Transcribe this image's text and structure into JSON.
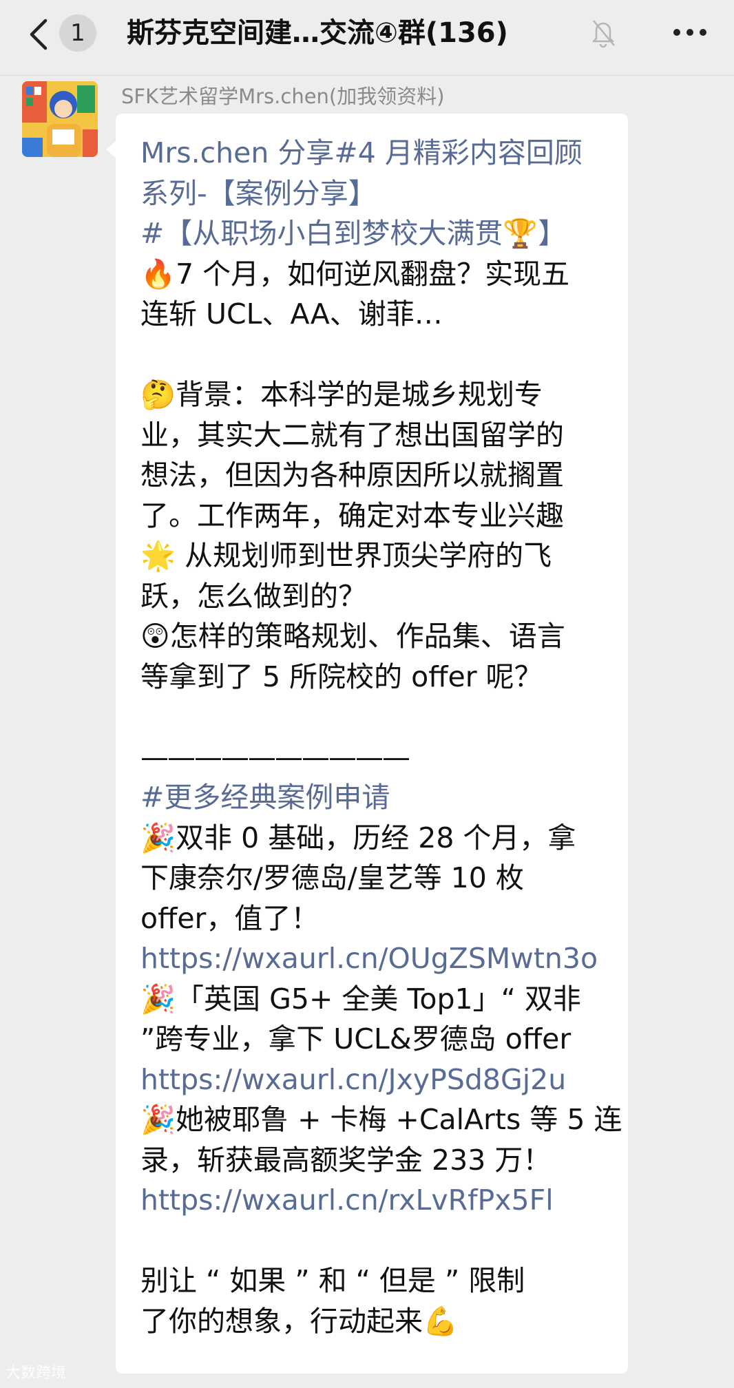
{
  "header": {
    "unread_count": "1",
    "title": "斯芬克空间建…交流④群(136)",
    "icons": {
      "back": "chevron-left-icon",
      "mute": "bell-muted-icon",
      "more": "more-dots-icon"
    }
  },
  "message": {
    "sender": "SFK艺术留学Mrs.chen(加我领资料)",
    "lines": [
      {
        "type": "mixed",
        "parts": [
          "Mrs.chen 分享",
          "#4 月精彩内容回顾"
        ]
      },
      {
        "type": "tag",
        "text": "系列-【案例分享】"
      },
      {
        "type": "tag",
        "text": " #【从职场小白到梦校大满贯🏆】"
      },
      {
        "type": "text",
        "text": " 🔥7 个月，如何逆风翻盘？实现五"
      },
      {
        "type": "text",
        "text": "连斩 UCL、AA、谢菲…"
      },
      {
        "type": "blank",
        "text": ""
      },
      {
        "type": "text",
        "text": "🤔背景：本科学的是城乡规划专"
      },
      {
        "type": "text",
        "text": "业，其实大二就有了想出国留学的"
      },
      {
        "type": "text",
        "text": "想法，但因为各种原因所以就搁置"
      },
      {
        "type": "text",
        "text": "了。工作两年，确定对本专业兴趣"
      },
      {
        "type": "text",
        "text": "🌟 从规划师到世界顶尖学府的飞"
      },
      {
        "type": "text",
        "text": "跃，怎么做到的？"
      },
      {
        "type": "text",
        "text": "😲怎样的策略规划、作品集、语言"
      },
      {
        "type": "text",
        "text": "等拿到了 5 所院校的 offer 呢？"
      },
      {
        "type": "blank",
        "text": ""
      },
      {
        "type": "divider",
        "text": "——————————"
      },
      {
        "type": "tag",
        "text": "#更多经典案例申请"
      },
      {
        "type": "text",
        "text": " 🎉双非 0 基础，历经 28 个月，拿"
      },
      {
        "type": "text",
        "text": "下康奈尔/罗德岛/皇艺等 10 枚"
      },
      {
        "type": "text",
        "text": "offer，值了！"
      },
      {
        "type": "link",
        "text": "https://wxaurl.cn/OUgZSMwtn3o"
      },
      {
        "type": "text",
        "text": "🎉「英国 G5+ 全美 Top1」“ 双非"
      },
      {
        "type": "text",
        "text": "”跨专业，拿下 UCL&罗德岛 offer"
      },
      {
        "type": "link",
        "text": "https://wxaurl.cn/JxyPSd8Gj2u"
      },
      {
        "type": "text",
        "text": "🎉她被耶鲁 + 卡梅 +CalArts 等 5 连"
      },
      {
        "type": "text",
        "text": "录，斩获最高额奖学金 233 万！"
      },
      {
        "type": "link",
        "text": "https://wxaurl.cn/rxLvRfPx5Fl"
      },
      {
        "type": "blank",
        "text": ""
      },
      {
        "type": "text",
        "text": "别让 “ 如果 ” 和 “ 但是 ” 限制"
      },
      {
        "type": "text",
        "text": "了你的想象，行动起来💪"
      }
    ]
  },
  "watermark": "大数跨境",
  "colors": {
    "background": "#ededed",
    "bubble": "#ffffff",
    "tag_link": "#576b95",
    "sender": "#8a8a8a"
  }
}
